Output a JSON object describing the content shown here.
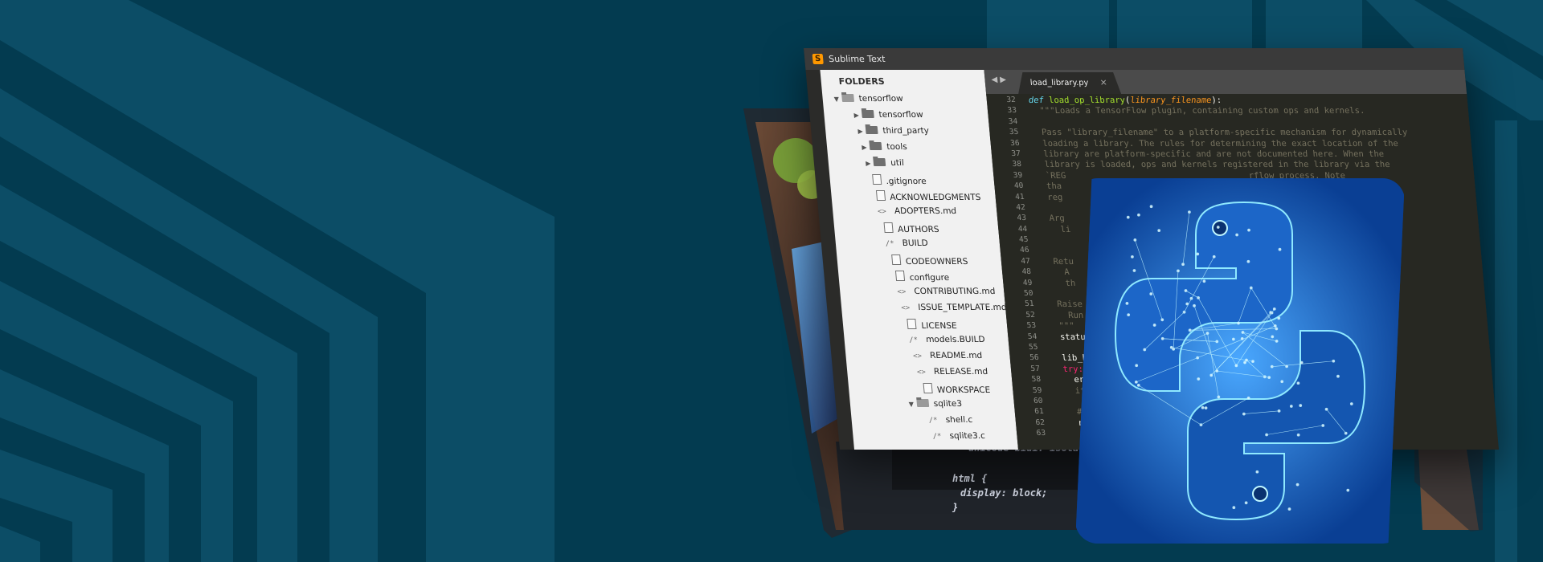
{
  "window": {
    "app_title": "Sublime Text",
    "app_icon": "sublime-logo-icon",
    "sidebar_heading": "FOLDERS",
    "tab": {
      "filename": "load_library.py",
      "close_glyph": "×"
    },
    "nav_arrows": "◀▶"
  },
  "tree": [
    {
      "label": "tensorflow",
      "type": "folder-open",
      "depth": 0
    },
    {
      "label": "tensorflow",
      "type": "folder",
      "depth": 1
    },
    {
      "label": "third_party",
      "type": "folder",
      "depth": 1
    },
    {
      "label": "tools",
      "type": "folder",
      "depth": 1
    },
    {
      "label": "util",
      "type": "folder",
      "depth": 1
    },
    {
      "label": ".gitignore",
      "type": "doc",
      "depth": 1
    },
    {
      "label": "ACKNOWLEDGMENTS",
      "type": "doc",
      "depth": 1
    },
    {
      "label": "ADOPTERS.md",
      "type": "code",
      "glyph": "<>",
      "depth": 1
    },
    {
      "label": "AUTHORS",
      "type": "doc",
      "depth": 1
    },
    {
      "label": "BUILD",
      "type": "code",
      "glyph": "/*",
      "depth": 1
    },
    {
      "label": "CODEOWNERS",
      "type": "doc",
      "depth": 1
    },
    {
      "label": "configure",
      "type": "doc",
      "depth": 1
    },
    {
      "label": "CONTRIBUTING.md",
      "type": "code",
      "glyph": "<>",
      "depth": 1
    },
    {
      "label": "ISSUE_TEMPLATE.md",
      "type": "code",
      "glyph": "<>",
      "depth": 1
    },
    {
      "label": "LICENSE",
      "type": "doc",
      "depth": 1
    },
    {
      "label": "models.BUILD",
      "type": "code",
      "glyph": "/*",
      "depth": 1
    },
    {
      "label": "README.md",
      "type": "code",
      "glyph": "<>",
      "depth": 1
    },
    {
      "label": "RELEASE.md",
      "type": "code",
      "glyph": "<>",
      "depth": 1
    },
    {
      "label": "WORKSPACE",
      "type": "doc",
      "depth": 1
    },
    {
      "label": "sqlite3",
      "type": "folder-open",
      "depth": 0
    },
    {
      "label": "shell.c",
      "type": "code",
      "glyph": "/*",
      "depth": 1
    },
    {
      "label": "sqlite3.c",
      "type": "code",
      "glyph": "/*",
      "depth": 1
    }
  ],
  "code": {
    "line_numbers": [
      "32",
      "33",
      "34",
      "35",
      "36",
      "37",
      "38",
      "39",
      "40",
      "41",
      "42",
      "43",
      "44",
      "45",
      "46",
      "47",
      "48",
      "49",
      "50",
      "51",
      "52",
      "53",
      "54",
      "55",
      "56",
      "57",
      "58",
      "59",
      "60",
      "61",
      "62",
      "63"
    ],
    "line_1": {
      "kw": "def",
      "fn": "load_op_library",
      "open": "(",
      "param": "library_filename",
      "close": "):"
    },
    "lines": [
      "",
      "  \"\"\"Loads a TensorFlow plugin, containing custom ops and kernels.",
      "",
      "  Pass \"library_filename\" to a platform-specific mechanism for dynamically",
      "  loading a library. The rules for determining the exact location of the",
      "  library are platform-specific and are not documented here. When the",
      "  library is loaded, ops and kernels registered in the library via the",
      "  `REG                                    rflow process. Note",
      "  tha                                    jected and not",
      "  reg",
      "",
      "  Arg",
      "    li                                    c library file.",
      "",
      "",
      "  Retu",
      "    A                                     Ops defined in",
      "    th",
      "",
      "  Raise",
      "    Run                                   t the python wrappers.",
      "  \"\"\"",
      "  statu",
      "",
      "  lib_ha                                  tatus)",
      "  try:",
      "    erro",
      "    if e",
      "      er",
      "    #",
      "    ra"
    ],
    "snippet": [
      "unicode-bidi: isolate;",
      "html {",
      "  display: block;",
      "}"
    ]
  },
  "colors": {
    "bg_dark": "#033c51",
    "bg_stripe": "#0d5068",
    "editor_bg": "#272822",
    "python_glow": "#7fe6ff"
  }
}
